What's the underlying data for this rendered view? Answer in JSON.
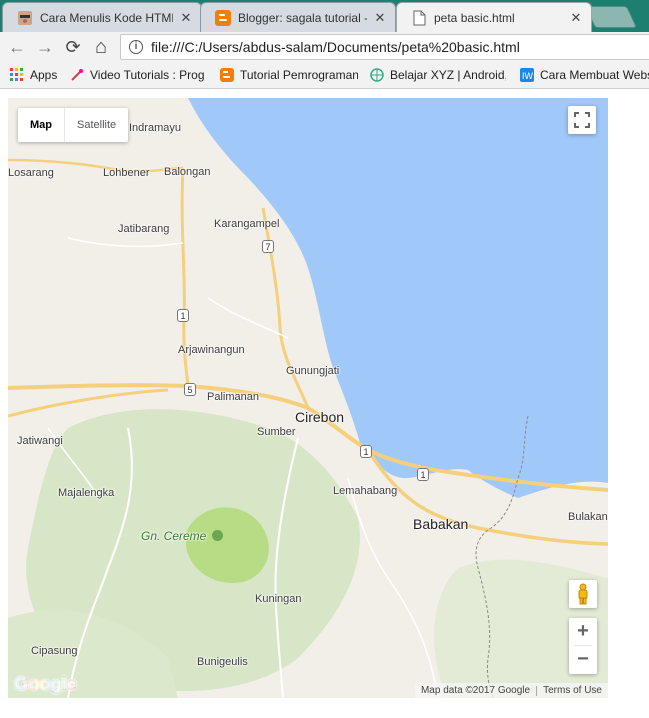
{
  "browser": {
    "tabs": [
      {
        "title": "Cara Menulis Kode HTML",
        "icon": "avatar-icon"
      },
      {
        "title": "Blogger: sagala tutorial -",
        "icon": "blogger-icon"
      },
      {
        "title": "peta basic.html",
        "icon": "page-icon",
        "active": true
      }
    ],
    "close_glyph": "✕",
    "address": "file:///C:/Users/abdus-salam/Documents/peta%20basic.html",
    "nav": {
      "back": "←",
      "forward": "→",
      "reload": "⟳",
      "home": "⌂"
    },
    "bookmarks": [
      {
        "label": "Apps",
        "icon": "apps-grid-icon"
      },
      {
        "label": "Video Tutorials : Prog",
        "icon": "video-tutorial-icon"
      },
      {
        "label": "Tutorial Pemrograman",
        "icon": "blogger-icon"
      },
      {
        "label": "Belajar XYZ | Android,",
        "icon": "globe-icon"
      },
      {
        "label": "Cara Membuat Webs",
        "icon": "bookmark-icon"
      }
    ]
  },
  "map": {
    "map_type": {
      "map": "Map",
      "satellite": "Satellite"
    },
    "places": {
      "indramayu": "Indramayu",
      "losarang": "Losarang",
      "lohbener": "Lohbener",
      "balongan": "Balongan",
      "karangampel": "Karangampel",
      "jatibarang": "Jatibarang",
      "arjawinangun": "Arjawinangun",
      "gunungjati": "Gunungjati",
      "palimanan": "Palimanan",
      "cirebon": "Cirebon",
      "sumber": "Sumber",
      "jatiwangi": "Jatiwangi",
      "majalengka": "Majalengka",
      "lemahabang": "Lemahabang",
      "babakan": "Babakan",
      "bulakan": "Bulakan",
      "cereme": "Gn. Cereme",
      "kuningan": "Kuningan",
      "cipasung": "Cipasung",
      "bunigeulis": "Bunigeulis"
    },
    "road_shields": [
      "7",
      "1",
      "5",
      "1",
      "1"
    ],
    "zoom_in": "+",
    "zoom_out": "−",
    "attribution": "Map data ©2017 Google",
    "terms": "Terms of Use",
    "logo": "Google",
    "colors": {
      "water": "#a0c8f8",
      "land": "#f2efe9",
      "park": "#cfe2bb",
      "road": "#f6cf7c",
      "volcano": "#b8dc86"
    }
  }
}
